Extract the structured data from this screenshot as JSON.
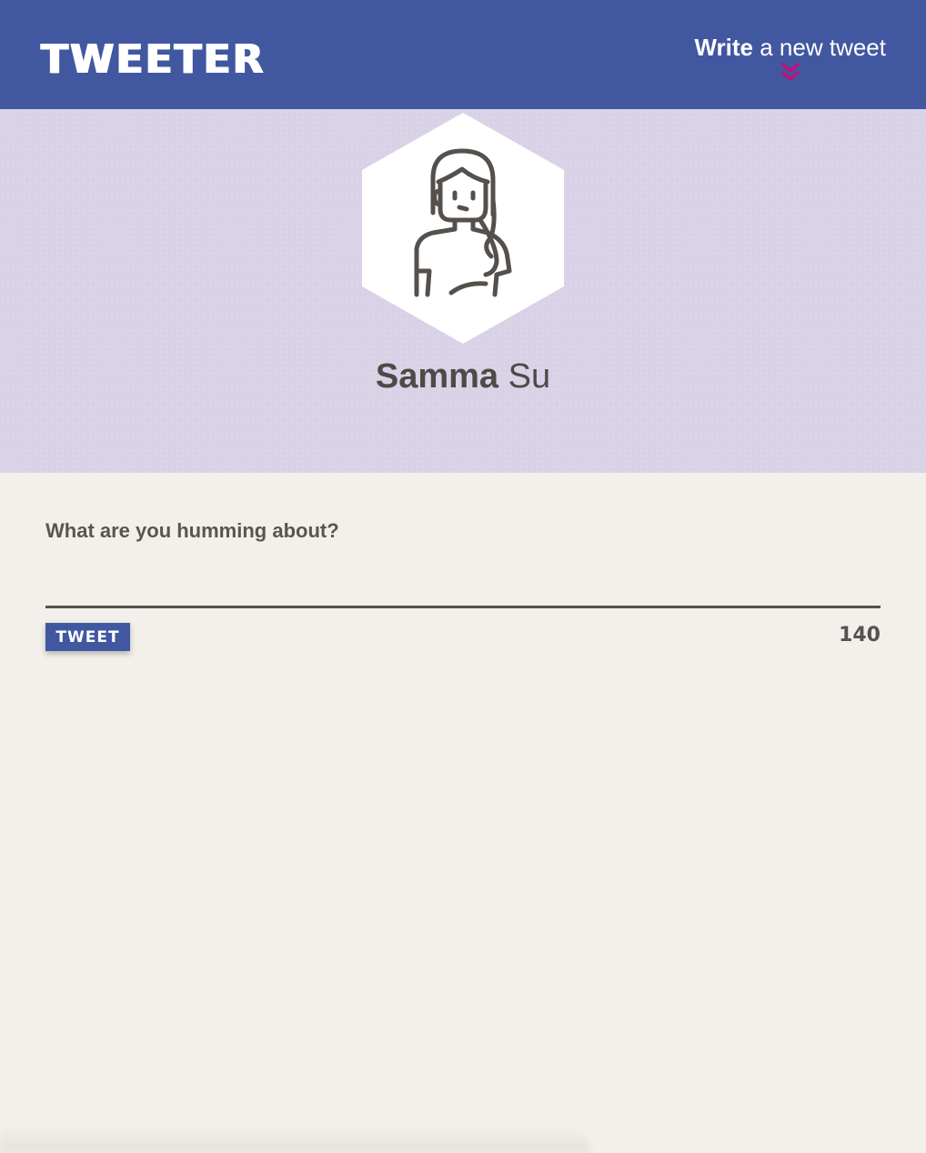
{
  "nav": {
    "logo": "TWEETER",
    "compose_toggle": {
      "strong": "Write",
      "rest": " a new tweet"
    },
    "chevron_icon": "double-chevron-down-icon",
    "accent_color": "#c0127a",
    "background_color": "#4157a0"
  },
  "profile": {
    "first_name": "Samma",
    "last_name": " Su",
    "avatar_icon": "user-avatar-icon",
    "background_color": "#d9d1e6"
  },
  "composer": {
    "prompt": "What are you humming about?",
    "textarea_value": "",
    "textarea_placeholder": "",
    "button_label": "TWEET",
    "counter": "140"
  }
}
